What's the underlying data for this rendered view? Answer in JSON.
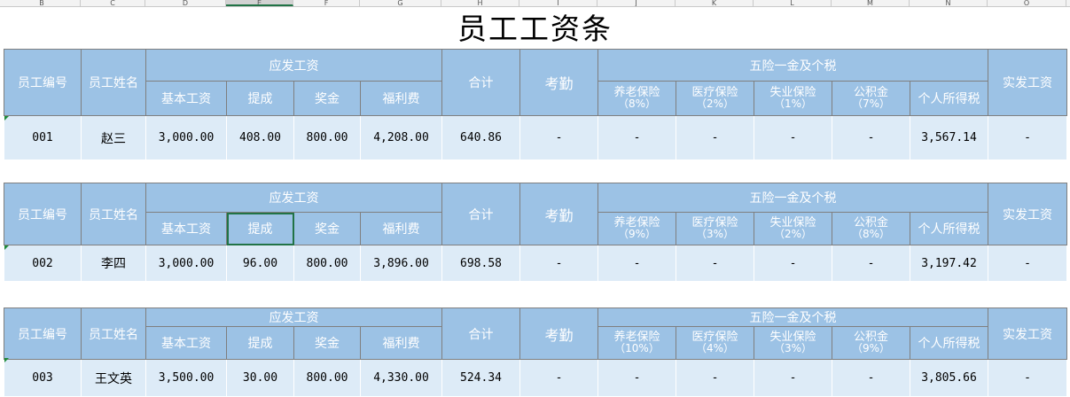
{
  "col_letters": [
    "B",
    "C",
    "D",
    "E",
    "F",
    "G",
    "H",
    "I",
    "J",
    "K",
    "L",
    "M",
    "N",
    "O"
  ],
  "title": "员工工资条",
  "headers": {
    "emp_id": "员工编号",
    "emp_name": "员工姓名",
    "gross_pay": "应发工资",
    "base_salary": "基本工资",
    "commission": "提成",
    "bonus": "奖金",
    "welfare": "福利费",
    "total": "合计",
    "attendance": "考勤",
    "insurance_group": "五险一金及个税",
    "pension": "养老保险",
    "medical": "医疗保险",
    "unemployment": "失业保险",
    "housing_fund": "公积金",
    "income_tax": "个人所得税",
    "net_pay": "实发工资"
  },
  "slips": [
    {
      "rates": {
        "pension": "（8%）",
        "medical": "（2%）",
        "unemployment": "（1%）",
        "housing_fund": "（7%）"
      },
      "row": {
        "id": "001",
        "name": "赵三",
        "base_salary": "3,000.00",
        "commission": "408.00",
        "bonus": "800.00",
        "welfare": "4,208.00",
        "total": "640.86",
        "attendance": "-",
        "pension": "-",
        "medical": "-",
        "unemployment": "-",
        "housing_fund": "-",
        "income_tax": "3,567.14",
        "net_pay": "-"
      }
    },
    {
      "rates": {
        "pension": "（9%）",
        "medical": "（3%）",
        "unemployment": "（2%）",
        "housing_fund": "（8%）"
      },
      "row": {
        "id": "002",
        "name": "李四",
        "base_salary": "3,000.00",
        "commission": "96.00",
        "bonus": "800.00",
        "welfare": "3,896.00",
        "total": "698.58",
        "attendance": "-",
        "pension": "-",
        "medical": "-",
        "unemployment": "-",
        "housing_fund": "-",
        "income_tax": "3,197.42",
        "net_pay": "-"
      }
    },
    {
      "rates": {
        "pension": "（10%）",
        "medical": "（4%）",
        "unemployment": "（3%）",
        "housing_fund": "（9%）"
      },
      "row": {
        "id": "003",
        "name": "王文英",
        "base_salary": "3,500.00",
        "commission": "30.00",
        "bonus": "800.00",
        "welfare": "4,330.00",
        "total": "524.34",
        "attendance": "-",
        "pension": "-",
        "medical": "-",
        "unemployment": "-",
        "housing_fund": "-",
        "income_tax": "3,805.66",
        "net_pay": "-"
      }
    }
  ],
  "colors": {
    "header_fill": "#9cc2e5",
    "data_fill": "#ddebf7",
    "header_text": "#ffffff",
    "selection": "#217346"
  }
}
